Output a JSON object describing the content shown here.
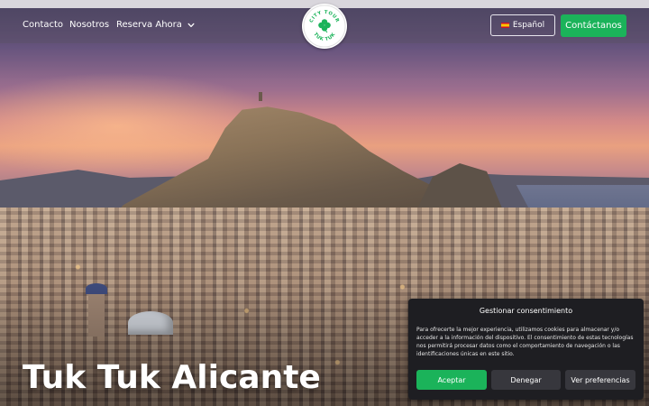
{
  "header": {
    "nav": {
      "contacto": "Contacto",
      "nosotros": "Nosotros",
      "reserva": "Reserva Ahora"
    },
    "logo": {
      "top_text": "CITY TOUR",
      "bottom_text": "TUK TUK",
      "icon": "clover-icon"
    },
    "language_button": "Español",
    "contact_button": "Contáctanos"
  },
  "hero": {
    "title": "Tuk Tuk Alicante"
  },
  "cookie_banner": {
    "title": "Gestionar consentimiento",
    "body": "Para ofrecerte la mejor experiencia, utilizamos cookies para almacenar y/o acceder a la información del dispositivo. El consentimiento de estas tecnologías nos permitirá procesar datos como el comportamiento de navegación o las identificaciones únicas en este sitio.",
    "accept": "Aceptar",
    "deny": "Denegar",
    "preferences": "Ver preferencias"
  },
  "colors": {
    "accent_green": "#1bb35a",
    "cookie_bg": "#1e1e22",
    "cookie_button": "#37373d"
  }
}
